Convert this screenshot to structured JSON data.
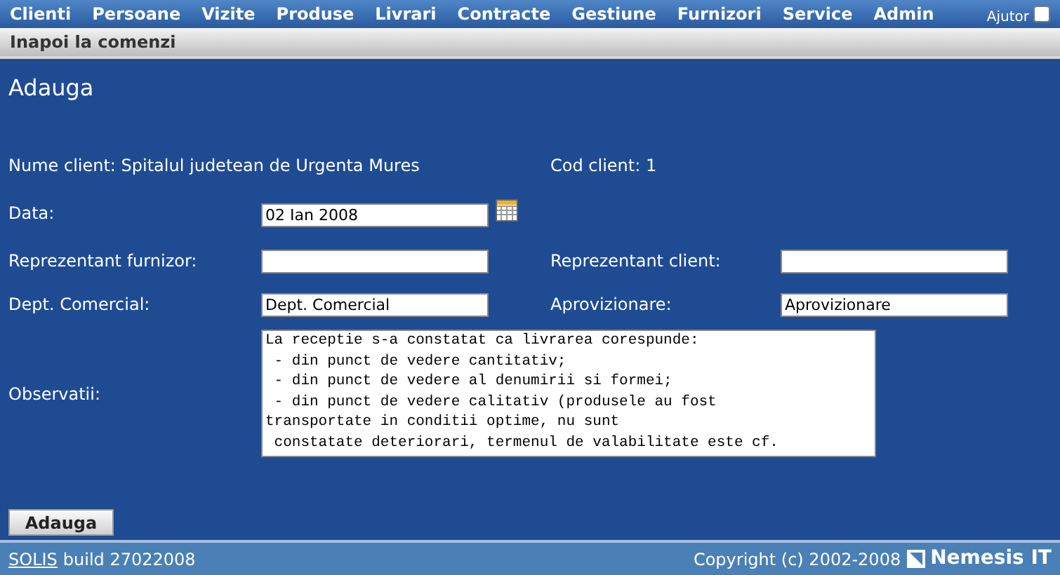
{
  "menu": [
    "Clienti",
    "Persoane",
    "Vizite",
    "Produse",
    "Livrari",
    "Contracte",
    "Gestiune",
    "Furnizori",
    "Service",
    "Admin"
  ],
  "help": {
    "label": "Ajutor",
    "checked": false
  },
  "back_link": "Inapoi la comenzi",
  "title": "Adauga",
  "client_name": "Nume client: Spitalul judetean de Urgenta Mures",
  "client_code": "Cod client: 1",
  "date": {
    "label": "Data:",
    "value": "02 Ian 2008"
  },
  "fields": [
    {
      "label": "Reprezentant furnizor:"
    },
    {
      "label": "Reprezentant client:"
    },
    {
      "label": "Dept. Comercial:",
      "value": "Dept. Comercial"
    },
    {
      "label": "Aprovizionare:",
      "value": "Aprovizionare"
    }
  ],
  "notes": {
    "label": "Observatii:",
    "value": "La receptie s-a constatat ca livrarea corespunde:\n - din punct de vedere cantitativ;\n - din punct de vedere al denumirii si formei;\n - din punct de vedere calitativ (produsele au fost\ntransportate in conditii optime, nu sunt\n constatate deteriorari, termenul de valabilitate este cf."
  },
  "submit": "Adauga",
  "footer": {
    "product": "SOLIS",
    "build": "build 27022008",
    "copyright": "Copyright (c) 2002-2008",
    "brand": "Nemesis IT"
  }
}
